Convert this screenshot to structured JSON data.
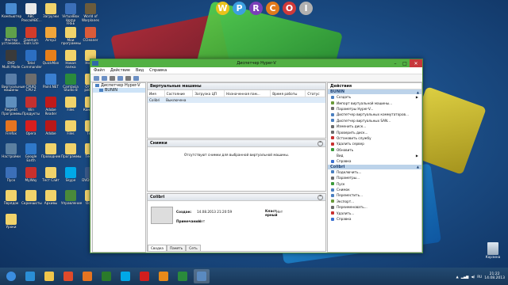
{
  "desktop": {
    "top_icons": [
      "W",
      "P",
      "R",
      "C",
      "O",
      "I"
    ],
    "recycle_label": "Корзина",
    "icons": [
      {
        "label": "Компьютер",
        "color": "#4a8bd1"
      },
      {
        "label": "ABC\nPascalABC...",
        "color": "#e9e9e9"
      },
      {
        "label": "Загрузки",
        "color": "#f1d36b"
      },
      {
        "label": "VirtualBox\nHome FREE",
        "color": "#3b6fb8"
      },
      {
        "label": "World of\nWarplanes",
        "color": "#6b5b3c"
      },
      {
        "label": "Мастер\nустановки...",
        "color": "#5fa04a"
      },
      {
        "label": "Daemon\nTools Lite",
        "color": "#d23b2a"
      },
      {
        "label": "Aimp3",
        "color": "#f0a53a"
      },
      {
        "label": "Мои\nпрограммы",
        "color": "#f1d36b"
      },
      {
        "label": "CCleaner",
        "color": "#d95b3a"
      },
      {
        "label": "DVD\nMulti Mode",
        "color": "#3a3a3a"
      },
      {
        "label": "Total\nCommander",
        "color": "#2c6fc2"
      },
      {
        "label": "QuickMan",
        "color": "#e67f1a"
      },
      {
        "label": "Новая\nпапка",
        "color": "#f1d36b"
      },
      {
        "label": "Новая",
        "color": "#f1d36b"
      },
      {
        "label": "Виртуальные\nмашины",
        "color": "#5a7ea8"
      },
      {
        "label": "CPUID CPU-Z",
        "color": "#6d6d6d"
      },
      {
        "label": "Paint.NET",
        "color": "#3a7fd0"
      },
      {
        "label": "Camtasia\nStudio 8",
        "color": "#2a8a3c"
      },
      {
        "label": "Отчёт работа",
        "color": "#f1d36b"
      },
      {
        "label": "Regedit\nПрограммы",
        "color": "#5f8fbd"
      },
      {
        "label": "Win\nПродукты",
        "color": "#c43030"
      },
      {
        "label": "Adobe Reader",
        "color": "#c01a1a"
      },
      {
        "label": "Files",
        "color": "#f1d36b"
      },
      {
        "label": "Конкурс",
        "color": "#f1d36b"
      },
      {
        "label": "Firefox",
        "color": "#e57420"
      },
      {
        "label": "Opera",
        "color": "#d81e1e"
      },
      {
        "label": "Adobe",
        "color": "#b81818"
      },
      {
        "label": "Files",
        "color": "#f1d36b"
      },
      {
        "label": "Тест",
        "color": "#f1d36b"
      },
      {
        "label": "Настройки",
        "color": "#5b7fa0"
      },
      {
        "label": "Google\nEarth",
        "color": "#2f78c9"
      },
      {
        "label": "Проводник",
        "color": "#f1d36b"
      },
      {
        "label": "Программы",
        "color": "#f1d36b"
      },
      {
        "label": "Тесты",
        "color": "#f1d36b"
      },
      {
        "label": "Пуск",
        "color": "#3b6fb8"
      },
      {
        "label": "MyWay",
        "color": "#c9302c"
      },
      {
        "label": "Тест Сайт",
        "color": "#f1d36b"
      },
      {
        "label": "Skype",
        "color": "#00a8e8"
      },
      {
        "label": "DVDStyler",
        "color": "#3a5a8a"
      },
      {
        "label": "Порядок",
        "color": "#f1d36b"
      },
      {
        "label": "Скриншоты",
        "color": "#f1d36b"
      },
      {
        "label": "Архивы",
        "color": "#f1d36b"
      },
      {
        "label": "Управление",
        "color": "#4a8a3a"
      },
      {
        "label": "Офис",
        "color": "#f1d36b"
      },
      {
        "label": "Уроки",
        "color": "#f1d36b"
      }
    ]
  },
  "window": {
    "title": "Диспетчер Hyper-V",
    "menu": [
      "Файл",
      "Действие",
      "Вид",
      "Справка"
    ],
    "tree": {
      "root": "Диспетчер Hyper-V",
      "child": "BUNIN"
    },
    "vm_panel": {
      "title": "Виртуальные машины",
      "columns": [
        "Имя",
        "Состояние",
        "Загрузка ЦП",
        "Назначенная пам...",
        "Время работы",
        "Статус"
      ],
      "rows": [
        {
          "name": "Colibri",
          "state": "Выключена",
          "cpu": "",
          "mem": "",
          "uptime": "",
          "status": ""
        }
      ]
    },
    "snapshots_panel": {
      "title": "Снимки",
      "message": "Отсутствуют снимки для выбранной виртуальной машины."
    },
    "details_panel": {
      "title": "Colibri",
      "created_label": "Создан:",
      "created_value": "14.08.2013 21:20:59",
      "notes_label": "Примечания:",
      "notes_value": "Нет",
      "cluster_label": "Класт\nерный",
      "cluster_value": "Нет",
      "tabs": [
        "Сводка",
        "Память",
        "Сеть"
      ]
    },
    "actions_panel": {
      "title": "Действия",
      "host_section": "BUNIN",
      "host_actions": [
        {
          "label": "Создать",
          "icon": "create-icon",
          "color": "#4a7fc0",
          "submenu": true
        },
        {
          "label": "Импорт виртуальной машины...",
          "icon": "import-icon",
          "color": "#6a9a3a",
          "submenu": false
        },
        {
          "label": "Параметры Hyper-V...",
          "icon": "settings-icon",
          "color": "#6b6b6b",
          "submenu": false
        },
        {
          "label": "Диспетчер виртуальных коммутаторов...",
          "icon": "switch-icon",
          "color": "#4a7fc0",
          "submenu": false
        },
        {
          "label": "Диспетчер виртуальных SAN...",
          "icon": "san-icon",
          "color": "#4a7fc0",
          "submenu": false
        },
        {
          "label": "Изменить диск...",
          "icon": "disk-icon",
          "color": "#6b6b6b",
          "submenu": false
        },
        {
          "label": "Проверить диск...",
          "icon": "inspect-icon",
          "color": "#6b6b6b",
          "submenu": false
        },
        {
          "label": "Остановить службу",
          "icon": "stop-icon",
          "color": "#c83030",
          "submenu": false
        },
        {
          "label": "Удалить сервер",
          "icon": "delete-icon",
          "color": "#c83030",
          "submenu": false
        },
        {
          "label": "Обновить",
          "icon": "refresh-icon",
          "color": "#3a9a3a",
          "submenu": false
        },
        {
          "label": "Вид",
          "icon": "view-icon",
          "color": "#ffffff",
          "submenu": true
        },
        {
          "label": "Справка",
          "icon": "help-icon",
          "color": "#3a6fd0",
          "submenu": false
        }
      ],
      "vm_section": "Colibri",
      "vm_actions": [
        {
          "label": "Подключить...",
          "icon": "connect-icon",
          "color": "#4a7fc0"
        },
        {
          "label": "Параметры...",
          "icon": "settings-icon",
          "color": "#6b6b6b"
        },
        {
          "label": "Пуск",
          "icon": "start-icon",
          "color": "#3a9a3a"
        },
        {
          "label": "Снимок",
          "icon": "snapshot-icon",
          "color": "#4a7fc0"
        },
        {
          "label": "Переместить...",
          "icon": "move-icon",
          "color": "#4a7fc0"
        },
        {
          "label": "Экспорт...",
          "icon": "export-icon",
          "color": "#6a9a3a"
        },
        {
          "label": "Переименовать...",
          "icon": "rename-icon",
          "color": "#6b6b6b"
        },
        {
          "label": "Удалить...",
          "icon": "delete-icon",
          "color": "#c83030"
        },
        {
          "label": "Справка",
          "icon": "help-icon",
          "color": "#3a6fd0"
        }
      ]
    }
  },
  "taskbar": {
    "apps": [
      {
        "name": "ie",
        "color": "#2a8ed6",
        "active": false
      },
      {
        "name": "explorer",
        "color": "#f1c64a",
        "active": false
      },
      {
        "name": "chrome",
        "color": "#e04a2a",
        "active": false
      },
      {
        "name": "firefox",
        "color": "#e57420",
        "active": false
      },
      {
        "name": "media",
        "color": "#2a7a2a",
        "active": false
      },
      {
        "name": "skype",
        "color": "#00a8e8",
        "active": false
      },
      {
        "name": "yandex",
        "color": "#d21e1e",
        "active": false
      },
      {
        "name": "wmp",
        "color": "#e88a1a",
        "active": false
      },
      {
        "name": "camtasia",
        "color": "#2a8a3c",
        "active": false
      },
      {
        "name": "hyperv",
        "color": "#5a8ac0",
        "active": true
      }
    ],
    "clock_time": "21:22",
    "clock_date": "14.08.2013"
  }
}
